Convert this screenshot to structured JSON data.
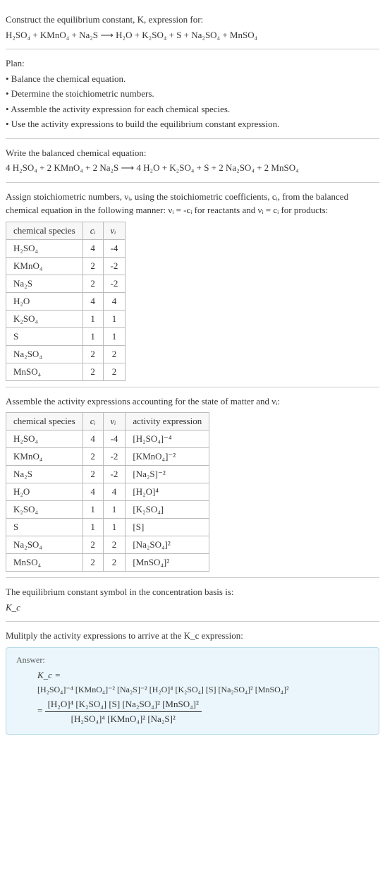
{
  "intro": {
    "line1": "Construct the equilibrium constant, K, expression for:",
    "eq_unbalanced": "H₂SO₄ + KMnO₄ + Na₂S ⟶ H₂O + K₂SO₄ + S + Na₂SO₄ + MnSO₄"
  },
  "plan": {
    "heading": "Plan:",
    "b1": "• Balance the chemical equation.",
    "b2": "• Determine the stoichiometric numbers.",
    "b3": "• Assemble the activity expression for each chemical species.",
    "b4": "• Use the activity expressions to build the equilibrium constant expression."
  },
  "balanced": {
    "heading": "Write the balanced chemical equation:",
    "eq": "4 H₂SO₄ + 2 KMnO₄ + 2 Na₂S ⟶ 4 H₂O + K₂SO₄ + S + 2 Na₂SO₄ + 2 MnSO₄"
  },
  "stoich": {
    "heading": "Assign stoichiometric numbers, νᵢ, using the stoichiometric coefficients, cᵢ, from the balanced chemical equation in the following manner: νᵢ = -cᵢ for reactants and νᵢ = cᵢ for products:",
    "headers": {
      "sp": "chemical species",
      "c": "cᵢ",
      "v": "νᵢ"
    },
    "rows": [
      {
        "sp": "H₂SO₄",
        "c": "4",
        "v": "-4"
      },
      {
        "sp": "KMnO₄",
        "c": "2",
        "v": "-2"
      },
      {
        "sp": "Na₂S",
        "c": "2",
        "v": "-2"
      },
      {
        "sp": "H₂O",
        "c": "4",
        "v": "4"
      },
      {
        "sp": "K₂SO₄",
        "c": "1",
        "v": "1"
      },
      {
        "sp": "S",
        "c": "1",
        "v": "1"
      },
      {
        "sp": "Na₂SO₄",
        "c": "2",
        "v": "2"
      },
      {
        "sp": "MnSO₄",
        "c": "2",
        "v": "2"
      }
    ]
  },
  "activity": {
    "heading": "Assemble the activity expressions accounting for the state of matter and νᵢ:",
    "headers": {
      "sp": "chemical species",
      "c": "cᵢ",
      "v": "νᵢ",
      "ae": "activity expression"
    },
    "rows": [
      {
        "sp": "H₂SO₄",
        "c": "4",
        "v": "-4",
        "ae": "[H₂SO₄]⁻⁴"
      },
      {
        "sp": "KMnO₄",
        "c": "2",
        "v": "-2",
        "ae": "[KMnO₄]⁻²"
      },
      {
        "sp": "Na₂S",
        "c": "2",
        "v": "-2",
        "ae": "[Na₂S]⁻²"
      },
      {
        "sp": "H₂O",
        "c": "4",
        "v": "4",
        "ae": "[H₂O]⁴"
      },
      {
        "sp": "K₂SO₄",
        "c": "1",
        "v": "1",
        "ae": "[K₂SO₄]"
      },
      {
        "sp": "S",
        "c": "1",
        "v": "1",
        "ae": "[S]"
      },
      {
        "sp": "Na₂SO₄",
        "c": "2",
        "v": "2",
        "ae": "[Na₂SO₄]²"
      },
      {
        "sp": "MnSO₄",
        "c": "2",
        "v": "2",
        "ae": "[MnSO₄]²"
      }
    ]
  },
  "eqconst": {
    "heading": "The equilibrium constant symbol in the concentration basis is:",
    "symbol": "K_c"
  },
  "final": {
    "heading": "Mulitply the activity expressions to arrive at the K_c expression:",
    "answer_label": "Answer:",
    "kc": "K_c =",
    "prod_line": "[H₂SO₄]⁻⁴ [KMnO₄]⁻² [Na₂S]⁻² [H₂O]⁴ [K₂SO₄] [S] [Na₂SO₄]² [MnSO₄]²",
    "eq": "=",
    "num": "[H₂O]⁴ [K₂SO₄] [S] [Na₂SO₄]² [MnSO₄]²",
    "den": "[H₂SO₄]⁴ [KMnO₄]² [Na₂S]²"
  }
}
